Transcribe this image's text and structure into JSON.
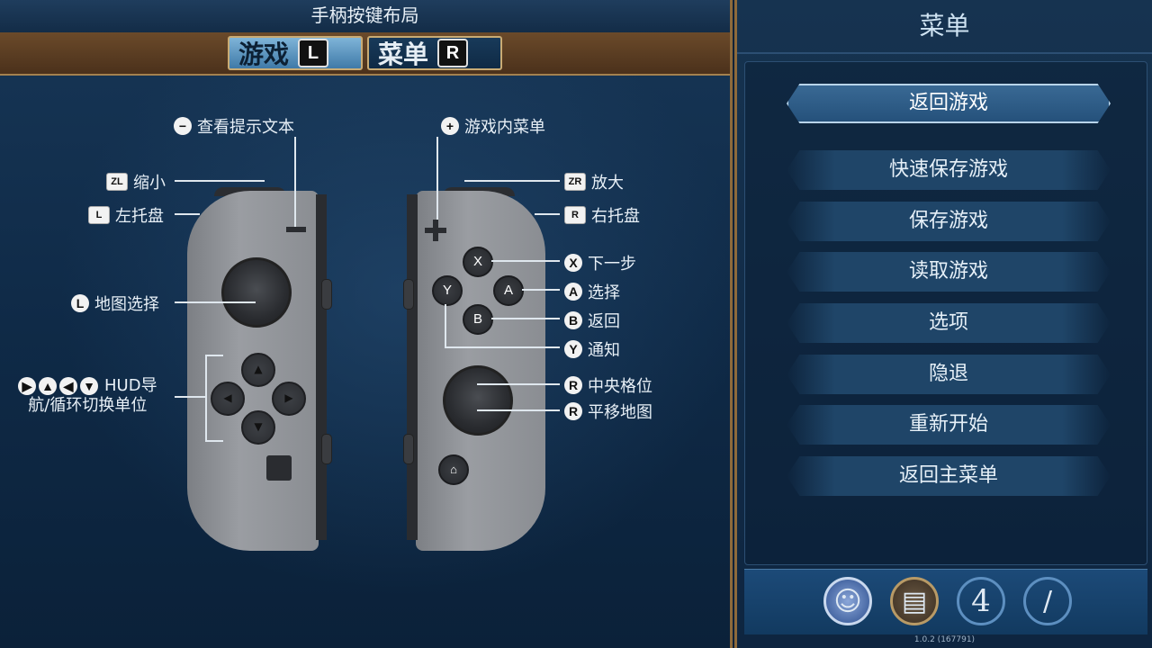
{
  "left": {
    "header_title": "手柄按键布局",
    "tabs": [
      {
        "label": "游戏",
        "key": "L",
        "active": true
      },
      {
        "label": "菜单",
        "key": "R",
        "active": false
      }
    ],
    "labels": {
      "minus": "查看提示文本",
      "zl": "缩小",
      "l": "左托盘",
      "lstick": "地图选择",
      "dpad_line1": "HUD导",
      "dpad_line2": "航/循环切换单位",
      "plus": "游戏内菜单",
      "zr": "放大",
      "r": "右托盘",
      "x": "下一步",
      "a": "选择",
      "b": "返回",
      "y": "通知",
      "rstick_press": "中央格位",
      "rstick": "平移地图"
    },
    "icon_glyphs": {
      "minus": "−",
      "plus": "+",
      "zl": "ZL",
      "l": "L",
      "zr": "ZR",
      "r": "R",
      "lstick": "L",
      "rstick": "R",
      "x": "X",
      "a": "A",
      "b": "B",
      "y": "Y"
    },
    "face_buttons": {
      "x": "X",
      "a": "A",
      "b": "B",
      "y": "Y"
    }
  },
  "right": {
    "title": "菜单",
    "items": [
      {
        "label": "返回游戏",
        "selected": true
      },
      {
        "label": "快速保存游戏",
        "selected": false
      },
      {
        "label": "保存游戏",
        "selected": false
      },
      {
        "label": "读取游戏",
        "selected": false
      },
      {
        "label": "选项",
        "selected": false
      },
      {
        "label": "隐退",
        "selected": false
      },
      {
        "label": "重新开始",
        "selected": false
      },
      {
        "label": "返回主菜单",
        "selected": false
      }
    ],
    "bottom_icons": [
      {
        "name": "leader-icon",
        "glyph": "☺"
      },
      {
        "name": "card-icon",
        "glyph": "▤"
      },
      {
        "name": "era-icon",
        "glyph": "4"
      },
      {
        "name": "clock-icon",
        "glyph": "/"
      }
    ],
    "version": "1.0.2 (167791)"
  },
  "colors": {
    "accent_gold": "#8d6a3c",
    "panel_blue": "#163350",
    "tab_active": "#7fb4d8"
  }
}
